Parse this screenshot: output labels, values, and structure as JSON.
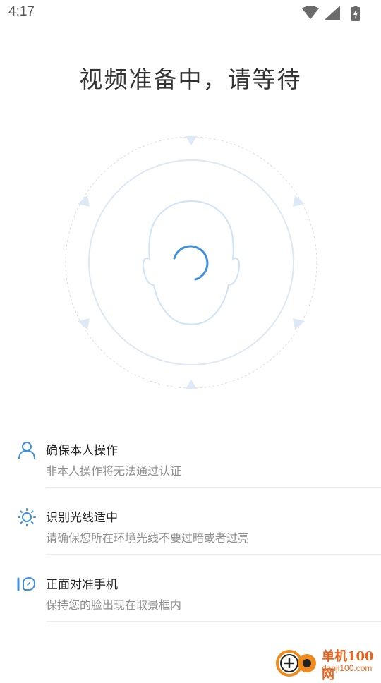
{
  "status_bar": {
    "time": "4:17",
    "icons": [
      "wifi-icon",
      "cell-signal-icon",
      "battery-charging-icon"
    ]
  },
  "title": "视频准备中，请等待",
  "scanner": {
    "state": "loading",
    "colors": {
      "ring": "#dfe8f3",
      "triangle": "#e4eefa",
      "face": "#cfe3f8",
      "spinner": "#3d8fe0"
    }
  },
  "tips": [
    {
      "icon": "person-icon",
      "title": "确保本人操作",
      "desc": "非本人操作将无法通过认证"
    },
    {
      "icon": "sun-icon",
      "title": "识别光线适中",
      "desc": "请确保您所在环境光线不要过暗或者过亮"
    },
    {
      "icon": "face-phone-icon",
      "title": "正面对准手机",
      "desc": "保持您的脸出现在取景框内"
    }
  ],
  "watermark": {
    "name": "单机100网",
    "url": "danji100.com",
    "color": "#e8641f"
  },
  "colors": {
    "accent": "#3d8fe0",
    "text": "#333333",
    "muted": "#8f8f8f"
  }
}
